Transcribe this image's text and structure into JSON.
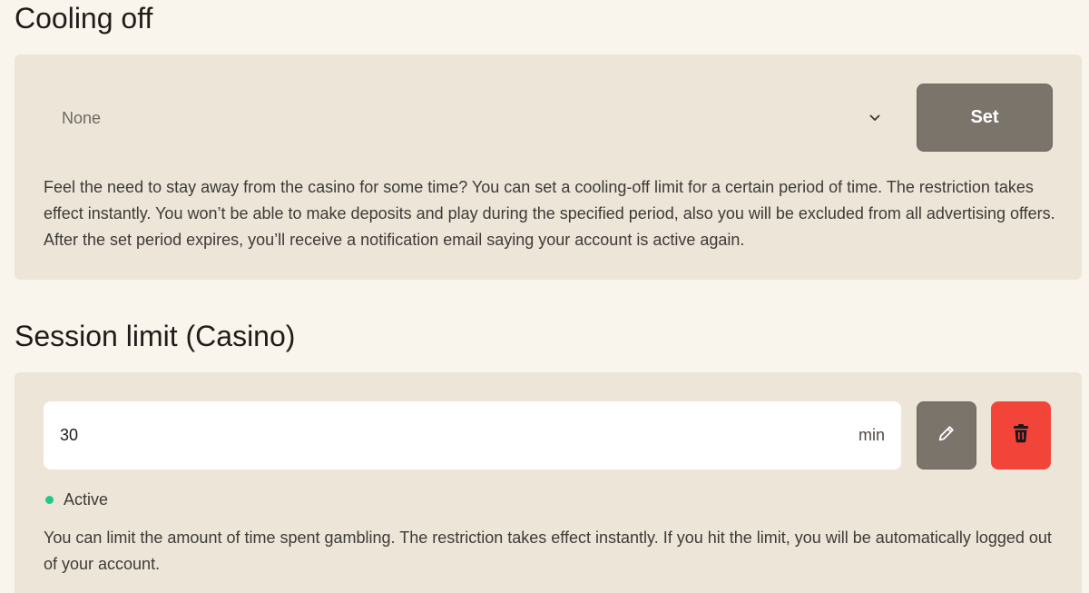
{
  "cooling_off": {
    "title": "Cooling off",
    "select_value": "None",
    "set_label": "Set",
    "description": "Feel the need to stay away from the casino for some time? You can set a cooling-off limit for a certain period of time. The restriction takes effect instantly. You won’t be able to make deposits and play during the specified period, also you will be excluded from all advertising offers. After the set period expires, you’ll receive a notification email saying your account is active again."
  },
  "session_limit": {
    "title": "Session limit (Casino)",
    "value": "30",
    "unit": "min",
    "status": "Active",
    "status_color": "#1fc987",
    "edit_icon": "pencil-icon",
    "delete_icon": "trash-icon",
    "description": "You can limit the amount of time spent gambling. The restriction takes effect instantly. If you hit the limit, you will be automatically logged out of your account."
  },
  "colors": {
    "background": "#f9f5ec",
    "card": "#ece5d8",
    "button_neutral": "#7a746b",
    "button_delete": "#f3443a"
  }
}
